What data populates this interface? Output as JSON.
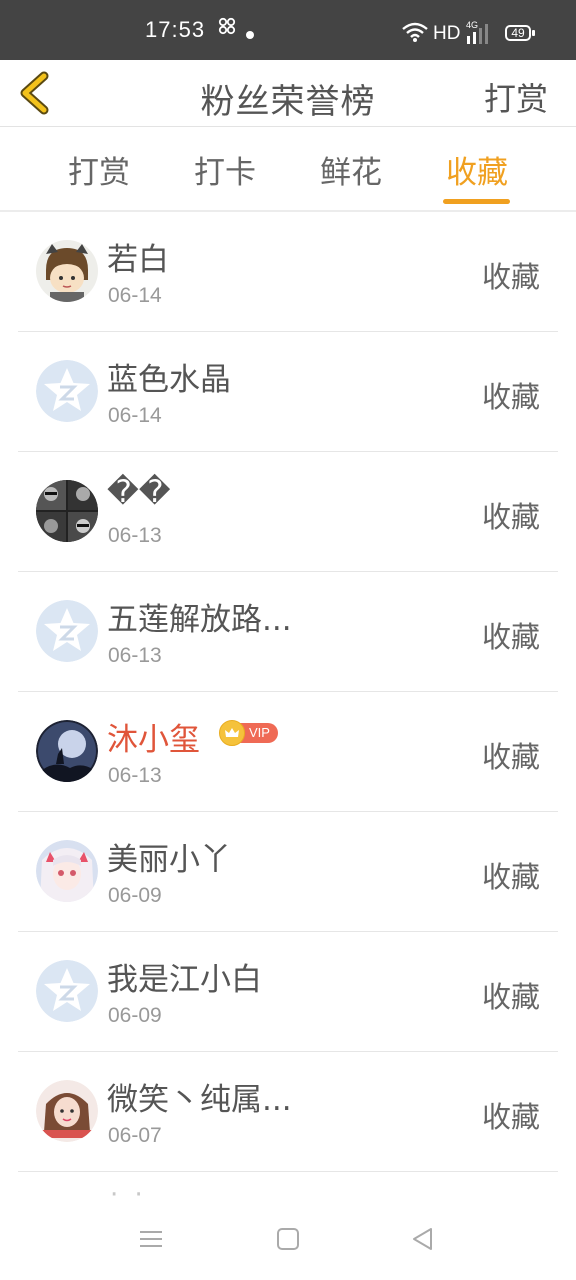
{
  "status_bar": {
    "time": "17:53",
    "hd": "HD",
    "network": "4G",
    "battery": "49"
  },
  "header": {
    "title": "粉丝荣誉榜",
    "action_label": "打赏"
  },
  "tabs": [
    {
      "label": "打赏",
      "active": false
    },
    {
      "label": "打卡",
      "active": false
    },
    {
      "label": "鲜花",
      "active": false
    },
    {
      "label": "收藏",
      "active": true
    }
  ],
  "accent_color": "#f0a020",
  "vip_name_color": "#e0553a",
  "rows": [
    {
      "name": "若白",
      "date": "06-14",
      "action": "收藏",
      "avatar": "cartoon-boy-avatar"
    },
    {
      "name": "蓝色水晶",
      "date": "06-14",
      "action": "收藏",
      "avatar": "default-qzone-avatar"
    },
    {
      "name": "��",
      "date": "06-13",
      "action": "收藏",
      "avatar": "grid-photo-avatar"
    },
    {
      "name": "五莲解放路...",
      "date": "06-13",
      "action": "收藏",
      "avatar": "default-qzone-avatar"
    },
    {
      "name": "沐小玺",
      "date": "06-13",
      "action": "收藏",
      "avatar": "moon-night-avatar",
      "vip": "VIP"
    },
    {
      "name": "美丽小丫",
      "date": "06-09",
      "action": "收藏",
      "avatar": "anime-girl-avatar"
    },
    {
      "name": "我是江小白",
      "date": "06-09",
      "action": "收藏",
      "avatar": "default-qzone-avatar"
    },
    {
      "name": "微笑丶纯属...",
      "date": "06-07",
      "action": "收藏",
      "avatar": "photo-girl-avatar"
    }
  ],
  "partial_row_text": "· ·",
  "bottom_nav": [
    "menu-icon",
    "home-square-icon",
    "back-triangle-icon"
  ]
}
